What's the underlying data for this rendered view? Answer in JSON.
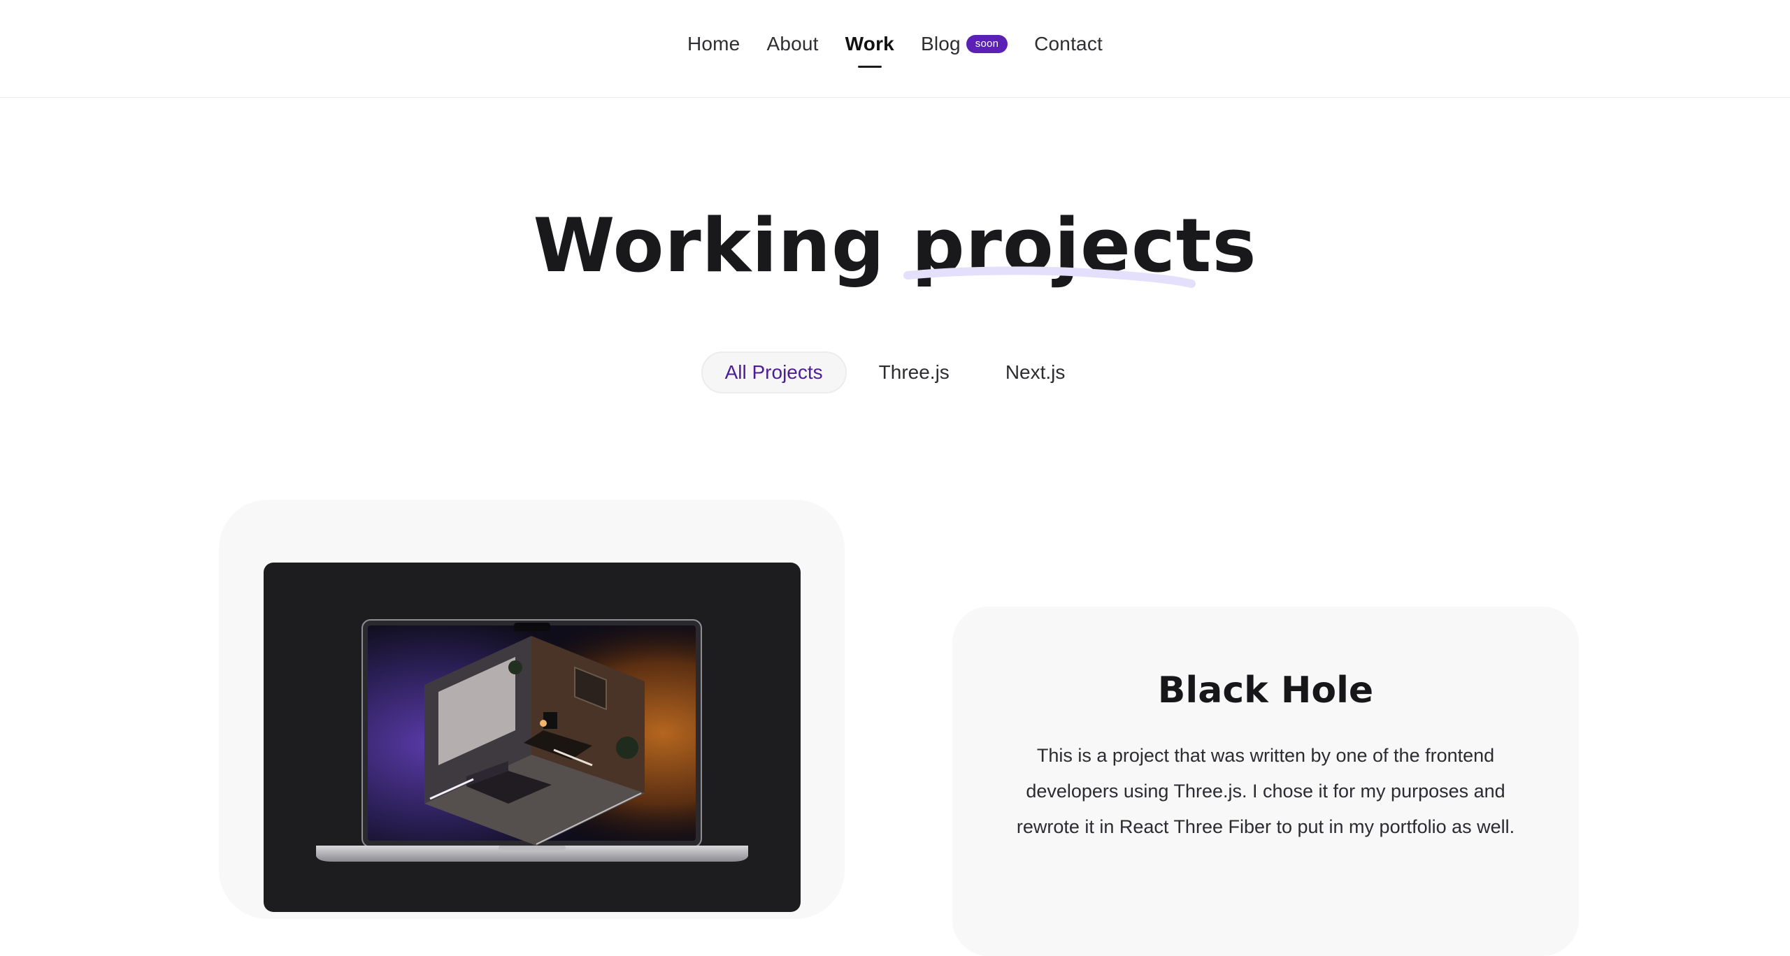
{
  "nav": {
    "items": [
      {
        "label": "Home"
      },
      {
        "label": "About"
      },
      {
        "label": "Work",
        "active": true
      },
      {
        "label": "Blog",
        "badge": "soon"
      },
      {
        "label": "Contact"
      }
    ]
  },
  "hero": {
    "title": "Working projects"
  },
  "filters": [
    {
      "label": "All Projects",
      "active": true
    },
    {
      "label": "Three.js"
    },
    {
      "label": "Next.js"
    }
  ],
  "project": {
    "title": "Black Hole",
    "description": "This is a project that was written by one of the frontend developers using Three.js. I chose it for my purposes and rewrote it in React Three Fiber to put in my portfolio as well."
  },
  "colors": {
    "accent": "#5b21b6",
    "accent_text": "#4c1d95",
    "underline_stroke": "#e4e0fb",
    "card_bg": "#f8f8f8",
    "media_bg": "#1d1c1f"
  }
}
